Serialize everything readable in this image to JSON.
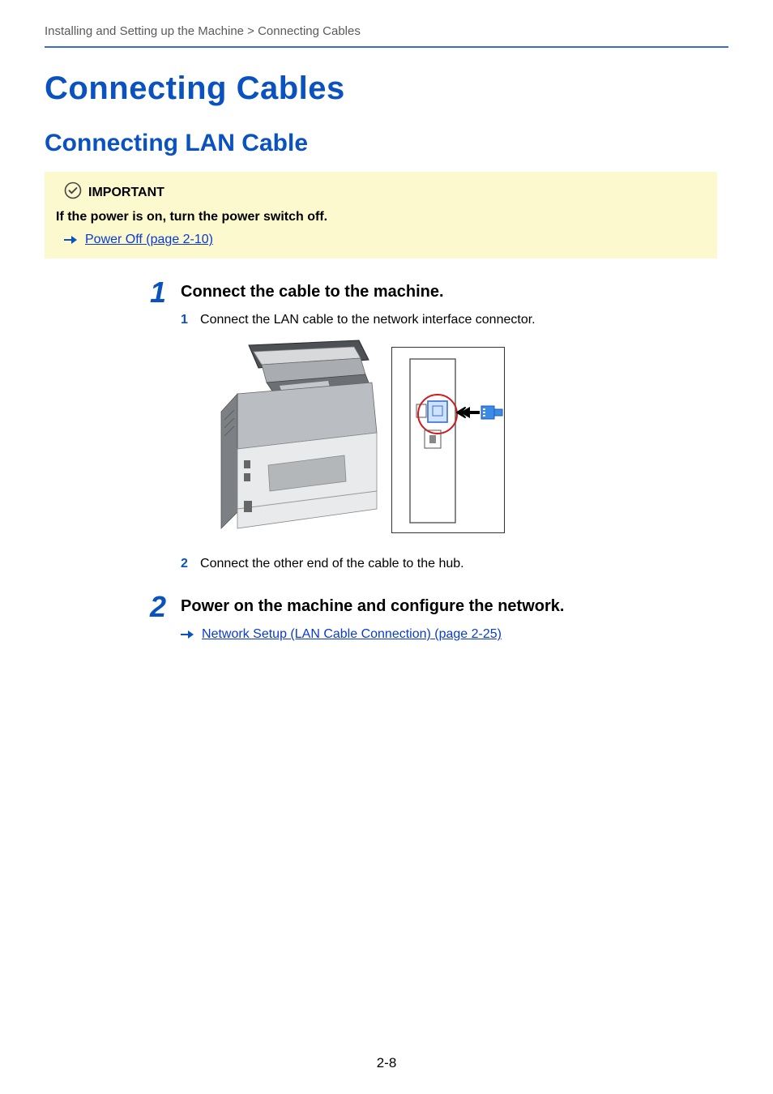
{
  "breadcrumb": "Installing and Setting up the Machine > Connecting Cables",
  "headings": {
    "h1": "Connecting Cables",
    "h2": "Connecting LAN Cable"
  },
  "important": {
    "label": "IMPORTANT",
    "text": "If the power is on, turn the power switch off.",
    "link_text": "Power Off (page 2-10)"
  },
  "steps": [
    {
      "num": "1",
      "title": "Connect the cable to the machine.",
      "substeps": [
        {
          "num": "1",
          "text": "Connect the LAN cable to the network interface connector."
        },
        {
          "num": "2",
          "text": "Connect the other end of the cable to the hub."
        }
      ]
    },
    {
      "num": "2",
      "title": "Power on the machine and configure the network.",
      "link_text": "Network Setup (LAN Cable Connection) (page 2-25)"
    }
  ],
  "page_number": "2-8"
}
